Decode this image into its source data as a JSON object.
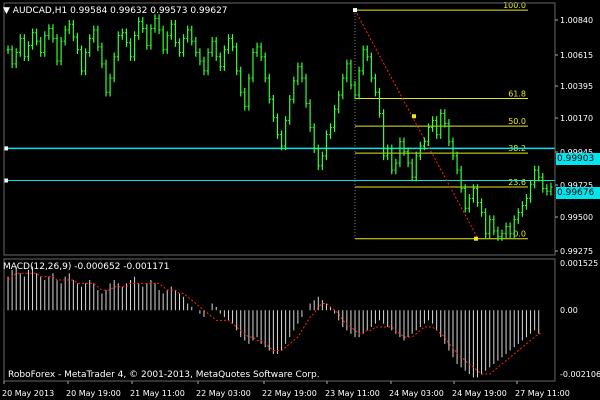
{
  "window": {
    "symbol_timeframe": "AUDCAD,H1",
    "ohlc": "0.99584 0.99632 0.99573 0.99627"
  },
  "colors": {
    "background": "#000000",
    "grid": "#3a4a5a",
    "bars": "#33ff33",
    "hline": "#00e5ee",
    "fibo": "#e8e81a",
    "trend": "#ff2020",
    "text": "#ffffff"
  },
  "fibo_labels": [
    "100.0",
    "61.8",
    "50.0",
    "38.2",
    "23.6",
    "0.0"
  ],
  "price_scale": [
    "1.00840",
    "1.00615",
    "1.00395",
    "1.00170",
    "0.99945",
    "0.99725",
    "0.99500",
    "0.99275"
  ],
  "current_price_labels": [
    "0.99903",
    "0.99676"
  ],
  "macd": {
    "label": "MACD(12,26,9) -0.000652 -0.001171",
    "scale": [
      "0.001525",
      "0.00",
      "-0.002106"
    ]
  },
  "time_axis": [
    "20 May 2013",
    "20 May 19:00",
    "21 May 11:00",
    "22 May 03:00",
    "22 May 19:00",
    "23 May 11:00",
    "24 May 03:00",
    "24 May 19:00",
    "27 May 11:00"
  ],
  "footer": "RoboForex - MetaTrader 4, © 2001-2013, MetaQuotes Software Corp.",
  "chart_data": {
    "type": "bar",
    "title": "AUDCAD,H1",
    "ylim": [
      0.9915,
      1.0093
    ],
    "closes": [
      1.006,
      1.005,
      1.0058,
      1.0068,
      1.0055,
      1.0063,
      1.0072,
      1.0066,
      1.0058,
      1.007,
      1.0075,
      1.0068,
      1.0052,
      1.0066,
      1.0074,
      1.0078,
      1.0069,
      1.006,
      1.0045,
      1.0058,
      1.0068,
      1.0074,
      1.0062,
      1.005,
      1.003,
      1.004,
      1.0055,
      1.007,
      1.0072,
      1.0065,
      1.0055,
      1.007,
      1.008,
      1.0075,
      1.0063,
      1.0075,
      1.0082,
      1.0074,
      1.006,
      1.007,
      1.0078,
      1.0065,
      1.0058,
      1.0068,
      1.0074,
      1.0066,
      1.0058,
      1.0052,
      1.0045,
      1.0058,
      1.0066,
      1.0055,
      1.0048,
      1.006,
      1.0068,
      1.0062,
      1.0045,
      1.003,
      1.002,
      1.004,
      1.0058,
      1.0062,
      1.0055,
      1.004,
      1.0025,
      1.0012,
      1.0,
      0.9992,
      1.001,
      1.0025,
      1.0038,
      1.0048,
      1.004,
      1.0022,
      1.0005,
      0.999,
      0.9978,
      0.9985,
      1.0,
      1.0005,
      1.0018,
      1.0028,
      1.004,
      1.005,
      1.0035,
      1.0028,
      1.0045,
      1.006,
      1.0055,
      1.004,
      1.003,
      1.0015,
      0.9985,
      0.999,
      0.9975,
      0.998,
      0.9995,
      0.9988,
      0.998,
      0.997,
      0.9985,
      0.9992,
      0.9995,
      1.0005,
      1.001,
      1.0,
      1.0015,
      1.0008,
      0.9995,
      0.9985,
      0.9975,
      0.9962,
      0.9948,
      0.9955,
      0.9962,
      0.9952,
      0.9945,
      0.993,
      0.994,
      0.9932,
      0.9928,
      0.993,
      0.9935,
      0.993,
      0.994,
      0.9945,
      0.995,
      0.9955,
      0.9965,
      0.9975,
      0.997,
      0.9962,
      0.996,
      0.9963
    ],
    "horizontal_lines": [
      0.99903,
      0.99676
    ],
    "fibo_levels": [
      {
        "label": "100.0",
        "price": 1.0088
      },
      {
        "label": "61.8",
        "price": 1.00255
      },
      {
        "label": "50.0",
        "price": 1.0006
      },
      {
        "label": "38.2",
        "price": 0.9987
      },
      {
        "label": "23.6",
        "price": 0.9963
      },
      {
        "label": "0.0",
        "price": 0.99265
      }
    ],
    "macd": {
      "ylim": [
        -0.002106,
        0.001525
      ],
      "histogram": [
        0.001,
        0.0012,
        0.0013,
        0.0011,
        0.001,
        0.0012,
        0.0013,
        0.0011,
        0.001,
        0.0009,
        0.001,
        0.0011,
        0.0009,
        0.0008,
        0.001,
        0.0011,
        0.0009,
        0.0008,
        0.0007,
        0.0008,
        0.0009,
        0.0008,
        0.0006,
        0.0005,
        0.0006,
        0.0008,
        0.0009,
        0.0008,
        0.0007,
        0.0008,
        0.0009,
        0.001,
        0.0008,
        0.0007,
        0.0008,
        0.0009,
        0.0008,
        0.0006,
        0.0005,
        0.0006,
        0.0007,
        0.0006,
        0.0005,
        0.0004,
        0.0002,
        0.0001,
        0.0,
        -0.0001,
        -0.0002,
        0.0,
        0.0002,
        0.0001,
        -0.0001,
        -0.0002,
        -0.0003,
        -0.0004,
        -0.0006,
        -0.0008,
        -0.0009,
        -0.001,
        -0.0009,
        -0.0008,
        -0.001,
        -0.0011,
        -0.0012,
        -0.0013,
        -0.0013,
        -0.0012,
        -0.001,
        -0.0008,
        -0.0006,
        -0.0004,
        -0.0002,
        0.0,
        0.0002,
        0.0003,
        0.0004,
        0.0003,
        0.0002,
        0.0001,
        -0.0001,
        -0.0003,
        -0.0005,
        -0.0006,
        -0.0007,
        -0.0008,
        -0.0008,
        -0.0007,
        -0.0006,
        -0.0005,
        -0.0004,
        -0.0003,
        -0.0004,
        -0.0005,
        -0.0006,
        -0.0007,
        -0.0008,
        -0.0009,
        -0.0008,
        -0.0007,
        -0.0006,
        -0.0005,
        -0.0004,
        -0.0003,
        -0.0004,
        -0.0006,
        -0.0008,
        -0.001,
        -0.0012,
        -0.0014,
        -0.0016,
        -0.0017,
        -0.0018,
        -0.0019,
        -0.002,
        -0.002,
        -0.0019,
        -0.0018,
        -0.0017,
        -0.0016,
        -0.0015,
        -0.0014,
        -0.0013,
        -0.0012,
        -0.0011,
        -0.001,
        -0.0009,
        -0.0008,
        -0.0007,
        -0.0006,
        -0.0007
      ],
      "signal": [
        0.0009,
        0.001,
        0.0011,
        0.0011,
        0.0011,
        0.0011,
        0.0011,
        0.0011,
        0.001,
        0.001,
        0.001,
        0.001,
        0.0009,
        0.0009,
        0.0009,
        0.0009,
        0.0009,
        0.0008,
        0.0008,
        0.0008,
        0.0008,
        0.0008,
        0.0007,
        0.0006,
        0.0006,
        0.0006,
        0.0007,
        0.0007,
        0.0007,
        0.0007,
        0.0008,
        0.0008,
        0.0008,
        0.0008,
        0.0008,
        0.0008,
        0.0008,
        0.0008,
        0.0007,
        0.0006,
        0.0006,
        0.0006,
        0.0005,
        0.0005,
        0.0004,
        0.0003,
        0.0002,
        0.0001,
        0.0,
        -0.0001,
        -0.0002,
        -0.0003,
        -0.0003,
        -0.0003,
        -0.0003,
        -0.0004,
        -0.0005,
        -0.0006,
        -0.0007,
        -0.0008,
        -0.0008,
        -0.0009,
        -0.0009,
        -0.001,
        -0.0011,
        -0.0012,
        -0.0012,
        -0.0012,
        -0.0011,
        -0.001,
        -0.0009,
        -0.0008,
        -0.0006,
        -0.0004,
        -0.0002,
        -0.0001,
        0.0001,
        0.0002,
        0.0002,
        0.0001,
        0.0,
        -0.0001,
        -0.0003,
        -0.0004,
        -0.0005,
        -0.0006,
        -0.0007,
        -0.0007,
        -0.0006,
        -0.0006,
        -0.0005,
        -0.0005,
        -0.0005,
        -0.0005,
        -0.0005,
        -0.0006,
        -0.0007,
        -0.0008,
        -0.0008,
        -0.0008,
        -0.0007,
        -0.0006,
        -0.0005,
        -0.0005,
        -0.0005,
        -0.0006,
        -0.0007,
        -0.0008,
        -0.001,
        -0.0011,
        -0.0013,
        -0.0014,
        -0.0015,
        -0.0016,
        -0.0017,
        -0.0018,
        -0.0019,
        -0.0019,
        -0.0019,
        -0.0018,
        -0.0017,
        -0.0016,
        -0.0015,
        -0.0014,
        -0.0013,
        -0.0012,
        -0.0011,
        -0.001,
        -0.0009,
        -0.0008,
        -0.0007,
        -0.0007
      ]
    }
  }
}
